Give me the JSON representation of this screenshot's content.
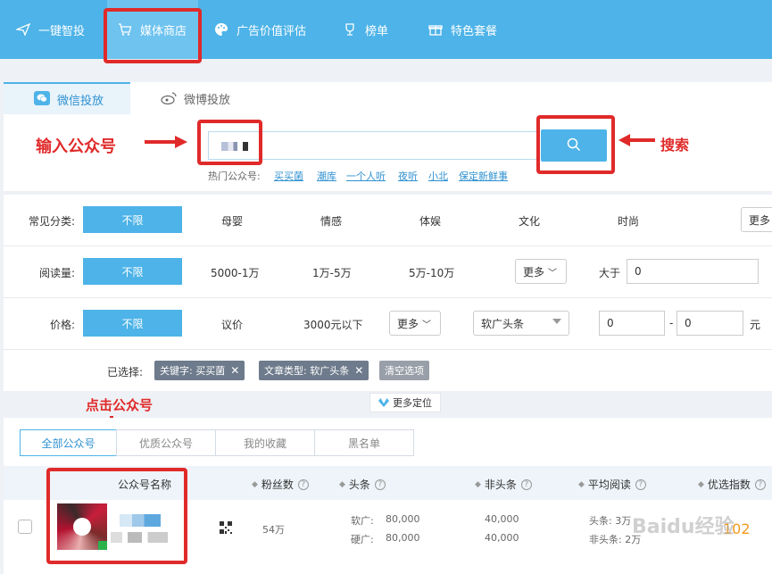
{
  "topnav": {
    "items": [
      {
        "label": "一键智投",
        "icon": "paper-plane-icon"
      },
      {
        "label": "媒体商店",
        "icon": "cart-icon",
        "active": true
      },
      {
        "label": "广告价值评估",
        "icon": "palette-icon"
      },
      {
        "label": "榜单",
        "icon": "trophy-icon"
      },
      {
        "label": "特色套餐",
        "icon": "gift-icon"
      }
    ]
  },
  "tabs": [
    {
      "label": "微信投放",
      "icon": "wechat-icon",
      "active": true
    },
    {
      "label": "微博投放",
      "icon": "weibo-icon"
    }
  ],
  "search": {
    "value": "",
    "hot_label": "热门公众号:",
    "hot_links": [
      "买买菌",
      "潮库",
      "一个人听",
      "夜听",
      "小北",
      "保定新鲜事"
    ]
  },
  "annotations": {
    "input_account": "输入公众号",
    "search": "搜索",
    "click_account": "点击公众号"
  },
  "filters": {
    "category": {
      "label": "常见分类:",
      "active": "不限",
      "options": [
        "母婴",
        "情感",
        "体娱",
        "文化",
        "时尚"
      ],
      "more": "更多"
    },
    "reads": {
      "label": "阅读量:",
      "active": "不限",
      "options": [
        "5000-1万",
        "1万-5万",
        "5万-10万"
      ],
      "more": "更多",
      "gt_label": "大于",
      "gt_value": "0"
    },
    "price": {
      "label": "价格:",
      "active": "不限",
      "options": [
        "议价",
        "3000元以下"
      ],
      "more": "更多",
      "ad_type": "软广头条",
      "min": "0",
      "dash": "-",
      "max": "0",
      "unit": "元"
    }
  },
  "selected": {
    "label": "已选择:",
    "chips": [
      "关键字: 买买菌",
      "文章类型: 软广头条"
    ],
    "clear": "清空选项",
    "more_locate": "更多定位"
  },
  "list_tabs": [
    "全部公众号",
    "优质公众号",
    "我的收藏",
    "黑名单"
  ],
  "table": {
    "headers": [
      "公众号名称",
      "粉丝数",
      "头条",
      "非头条",
      "平均阅读",
      "优选指数"
    ],
    "row": {
      "fans": "54万",
      "soft_label": "软广:",
      "soft_value": "80,000",
      "hard_label": "硬广:",
      "hard_value": "80,000",
      "nonhead_soft": "40,000",
      "nonhead_hard": "40,000",
      "avg_head": "头条: 3万",
      "avg_nonhead": "非头条: 2万",
      "score": "102"
    }
  },
  "watermark": "Baidu经验",
  "colors": {
    "accent": "#4db3e8",
    "annotation": "#e02a2a",
    "link": "#2f91d1"
  }
}
